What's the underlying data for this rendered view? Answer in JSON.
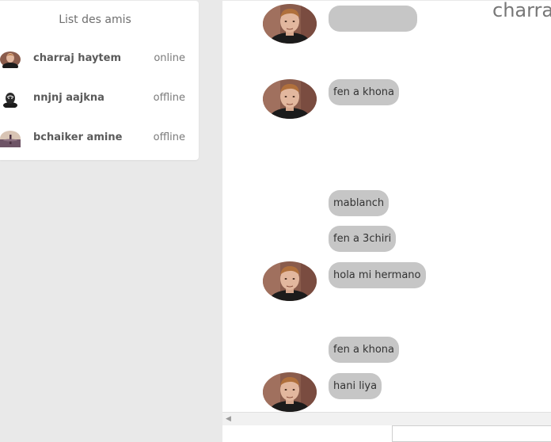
{
  "friends_panel": {
    "title": "List des amis",
    "friends": [
      {
        "name": "charraj haytem",
        "status": "online"
      },
      {
        "name": "nnjnj aajkna",
        "status": "offline"
      },
      {
        "name": "bchaiker amine",
        "status": "offline"
      }
    ]
  },
  "chat": {
    "title": "charra",
    "messages": [
      "fen a khona",
      "mablanch",
      "fen a 3chiri",
      "hola mi hermano",
      "fen a khona",
      "hani liya"
    ]
  },
  "composer": {
    "placeholder": ""
  }
}
